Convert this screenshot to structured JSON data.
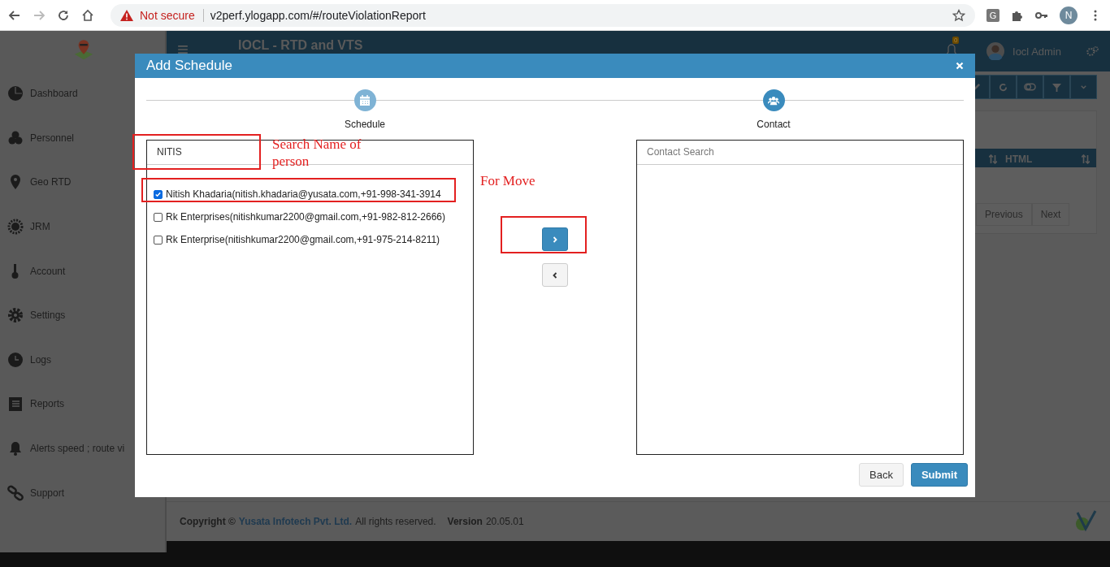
{
  "browser": {
    "security": "Not secure",
    "url": "v2perf.ylogapp.com/#/routeViolationReport",
    "extension": "G",
    "profile": "N"
  },
  "sidebar": {
    "items": [
      {
        "label": "Dashboard"
      },
      {
        "label": "Personnel"
      },
      {
        "label": "Geo RTD"
      },
      {
        "label": "JRM"
      },
      {
        "label": "Account"
      },
      {
        "label": "Settings"
      },
      {
        "label": "Logs"
      },
      {
        "label": "Reports"
      },
      {
        "label": "Alerts speed ; route vi"
      },
      {
        "label": "Support"
      }
    ]
  },
  "header": {
    "title": "IOCL - RTD and VTS",
    "notifications": "0",
    "user": "Iocl Admin"
  },
  "table": {
    "visible_column": "HTML",
    "pagination": [
      "Previous",
      "Next"
    ]
  },
  "footer": {
    "copyright": "Copyright ©",
    "company": "Yusata Infotech Pvt. Ltd.",
    "rights": "All rights reserved.",
    "version_label": "Version",
    "version": "20.05.01"
  },
  "modal": {
    "title": "Add Schedule",
    "steps": [
      {
        "label": "Schedule",
        "current": false
      },
      {
        "label": "Contact",
        "current": true
      }
    ],
    "search": {
      "value": "NITIS",
      "highlighted": true,
      "note": "Search Name of person"
    },
    "contacts": [
      {
        "label": "Nitish Khadaria(nitish.khadaria@yusata.com,+91-998-341-3914",
        "checked": true,
        "highlighted": true
      },
      {
        "label": "Rk Enterprises(nitishkumar2200@gmail.com,+91-982-812-2666)",
        "checked": false,
        "highlighted": false
      },
      {
        "label": "Rk Enterprise(nitishkumar2200@gmail.com,+91-975-214-8211)",
        "checked": false,
        "highlighted": false
      }
    ],
    "move_note": "For Move",
    "move_buttons": [
      {
        "kind": "move-right",
        "highlighted": true
      },
      {
        "kind": "move-left",
        "highlighted": false
      }
    ],
    "target_search": {
      "placeholder": "Contact Search"
    },
    "buttons": [
      {
        "label": "Back",
        "kind": "default"
      },
      {
        "label": "Submit",
        "kind": "primary"
      }
    ]
  }
}
